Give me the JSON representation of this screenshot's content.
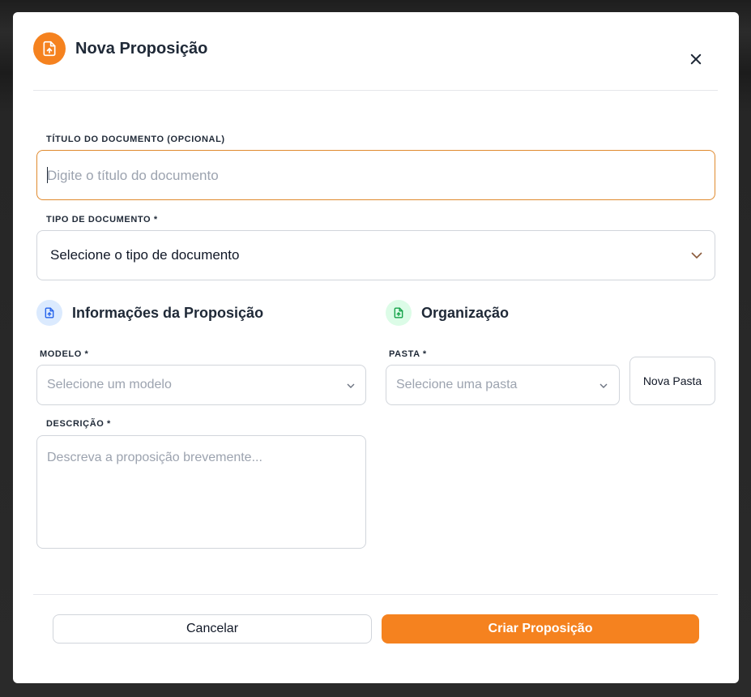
{
  "colors": {
    "accent": "#f5821f",
    "focus_border": "#e08a2e",
    "info_icon_bg": "#dbeafe",
    "info_icon_fg": "#2563eb",
    "org_icon_bg": "#dcfce7",
    "org_icon_fg": "#16a34a"
  },
  "modal": {
    "title": "Nova Proposição",
    "header_icon": "file-upload-icon",
    "close_icon": "close-icon"
  },
  "form": {
    "titulo": {
      "label": "TÍTULO DO DOCUMENTO (OPCIONAL)",
      "value": "",
      "placeholder": "Digite o título do documento"
    },
    "tipo": {
      "label": "TIPO DE DOCUMENTO *",
      "selected": "Selecione o tipo de documento"
    }
  },
  "sections": {
    "info": {
      "title": "Informações da Proposição",
      "icon": "file-text-icon",
      "modelo": {
        "label": "MODELO *",
        "selected": "Selecione um modelo"
      },
      "descricao": {
        "label": "DESCRIÇÃO *",
        "value": "",
        "placeholder": "Descreva a proposição brevemente..."
      }
    },
    "org": {
      "title": "Organização",
      "icon": "file-plus-icon",
      "pasta": {
        "label": "PASTA *",
        "selected": "Selecione uma pasta"
      },
      "new_folder_label": "Nova Pasta"
    }
  },
  "footer": {
    "cancel_label": "Cancelar",
    "submit_label": "Criar Proposição"
  }
}
